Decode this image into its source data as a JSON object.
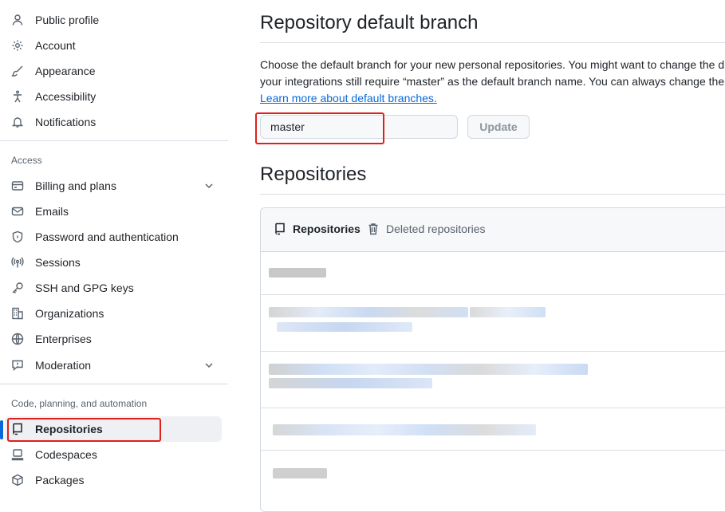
{
  "sidebar": {
    "top_items": [
      {
        "label": "Public profile",
        "icon": "person-icon"
      },
      {
        "label": "Account",
        "icon": "gear-icon"
      },
      {
        "label": "Appearance",
        "icon": "paintbrush-icon"
      },
      {
        "label": "Accessibility",
        "icon": "accessibility-icon"
      },
      {
        "label": "Notifications",
        "icon": "bell-icon"
      }
    ],
    "access_label": "Access",
    "access_items": [
      {
        "label": "Billing and plans",
        "icon": "credit-card-icon"
      },
      {
        "label": "Emails",
        "icon": "mail-icon"
      },
      {
        "label": "Password and authentication",
        "icon": "shield-lock-icon"
      },
      {
        "label": "Sessions",
        "icon": "broadcast-icon"
      },
      {
        "label": "SSH and GPG keys",
        "icon": "key-icon"
      },
      {
        "label": "Organizations",
        "icon": "organization-icon"
      },
      {
        "label": "Enterprises",
        "icon": "globe-icon"
      },
      {
        "label": "Moderation",
        "icon": "report-icon"
      }
    ],
    "code_label": "Code, planning, and automation",
    "code_items": [
      {
        "label": "Repositories",
        "icon": "repo-icon"
      },
      {
        "label": "Codespaces",
        "icon": "codespaces-icon"
      },
      {
        "label": "Packages",
        "icon": "package-icon"
      }
    ]
  },
  "main": {
    "branch_heading": "Repository default branch",
    "desc_line1": "Choose the default branch for your new personal repositories. You might want to change the d",
    "desc_line2": "your integrations still require “master” as the default branch name. You can always change the",
    "learn_more": "Learn more about default branches.",
    "branch_value": "master",
    "update_label": "Update",
    "repos_heading": "Repositories",
    "tabs": {
      "repositories": "Repositories",
      "deleted": "Deleted repositories"
    }
  },
  "colors": {
    "accent": "#0969da",
    "annotation_red": "#e0201b",
    "border": "#d1d9e0",
    "muted": "#59636e"
  }
}
